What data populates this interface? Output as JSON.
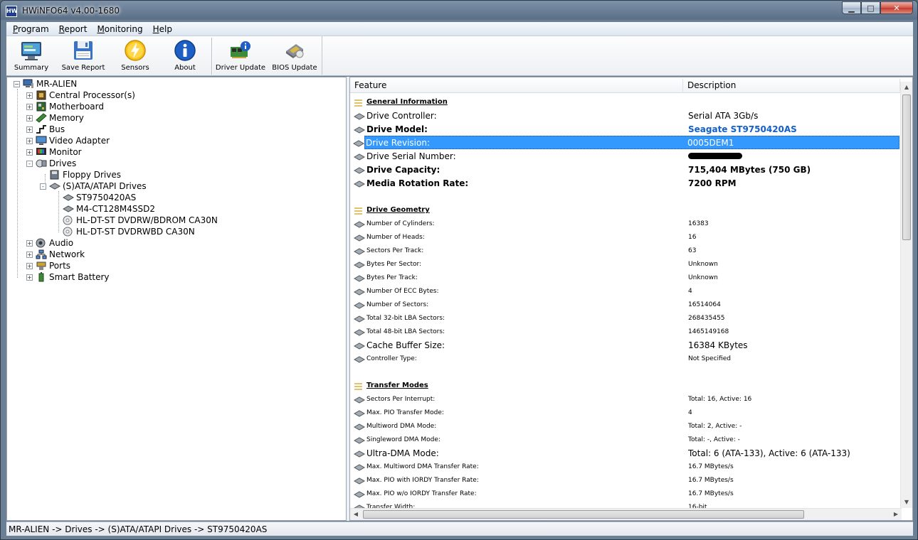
{
  "window": {
    "title": "HWiNFO64 v4.00-1680",
    "app_icon_text": "HW"
  },
  "menu": [
    "Program",
    "Report",
    "Monitoring",
    "Help"
  ],
  "toolbar": {
    "buttons": [
      {
        "label": "Summary",
        "icon": "summary-icon"
      },
      {
        "label": "Save Report",
        "icon": "floppy-disk-icon"
      },
      {
        "label": "Sensors",
        "icon": "sensors-lightning-icon"
      },
      {
        "label": "About",
        "icon": "info-icon"
      },
      {
        "label": "Driver Update",
        "icon": "driver-update-icon"
      },
      {
        "label": "BIOS Update",
        "icon": "bios-chip-icon"
      }
    ]
  },
  "tree": {
    "root": "MR-ALIEN",
    "nodes": [
      {
        "label": "Central Processor(s)",
        "expander": "+"
      },
      {
        "label": "Motherboard",
        "expander": "+"
      },
      {
        "label": "Memory",
        "expander": "+"
      },
      {
        "label": "Bus",
        "expander": "+"
      },
      {
        "label": "Video Adapter",
        "expander": "+"
      },
      {
        "label": "Monitor",
        "expander": "+"
      },
      {
        "label": "Drives",
        "expander": "-"
      },
      {
        "label": "Floppy Drives",
        "expander": ""
      },
      {
        "label": "(S)ATA/ATAPI Drives",
        "expander": "-"
      },
      {
        "label": "ST9750420AS",
        "expander": ""
      },
      {
        "label": "M4-CT128M4SSD2",
        "expander": ""
      },
      {
        "label": "HL-DT-ST DVDRW/BDROM CA30N",
        "expander": ""
      },
      {
        "label": "HL-DT-ST DVDRWBD CA30N",
        "expander": ""
      },
      {
        "label": "Audio",
        "expander": "+"
      },
      {
        "label": "Network",
        "expander": "+"
      },
      {
        "label": "Ports",
        "expander": "+"
      },
      {
        "label": "Smart Battery",
        "expander": "+"
      }
    ]
  },
  "details": {
    "columns": {
      "feature": "Feature",
      "description": "Description"
    },
    "rows": [
      {
        "feature": "General Information",
        "desc": "",
        "kind": "section"
      },
      {
        "feature": "Drive Controller:",
        "desc": "Serial ATA 3Gb/s",
        "kind": "med"
      },
      {
        "feature": "Drive Model:",
        "desc": "Seagate ST9750420AS",
        "kind": "bold-blue"
      },
      {
        "feature": "Drive Revision:",
        "desc": "0005DEM1",
        "kind": "selected"
      },
      {
        "feature": "Drive Serial Number:",
        "desc": "",
        "kind": "redacted"
      },
      {
        "feature": "Drive Capacity:",
        "desc": "715,404 MBytes (750 GB)",
        "kind": "bold"
      },
      {
        "feature": "Media Rotation Rate:",
        "desc": "7200 RPM",
        "kind": "bold"
      },
      {
        "feature": "",
        "desc": "",
        "kind": "blank"
      },
      {
        "feature": "Drive Geometry",
        "desc": "",
        "kind": "section"
      },
      {
        "feature": "Number of Cylinders:",
        "desc": "16383",
        "kind": "small"
      },
      {
        "feature": "Number of Heads:",
        "desc": "16",
        "kind": "small"
      },
      {
        "feature": "Sectors Per Track:",
        "desc": "63",
        "kind": "small"
      },
      {
        "feature": "Bytes Per Sector:",
        "desc": "Unknown",
        "kind": "small"
      },
      {
        "feature": "Bytes Per Track:",
        "desc": "Unknown",
        "kind": "small"
      },
      {
        "feature": "Number Of ECC Bytes:",
        "desc": "4",
        "kind": "small"
      },
      {
        "feature": "Number of Sectors:",
        "desc": "16514064",
        "kind": "small"
      },
      {
        "feature": "Total 32-bit LBA Sectors:",
        "desc": "268435455",
        "kind": "small"
      },
      {
        "feature": "Total 48-bit LBA Sectors:",
        "desc": "1465149168",
        "kind": "small"
      },
      {
        "feature": "Cache Buffer Size:",
        "desc": "16384 KBytes",
        "kind": "med"
      },
      {
        "feature": "Controller Type:",
        "desc": "Not Specified",
        "kind": "small"
      },
      {
        "feature": "",
        "desc": "",
        "kind": "blank"
      },
      {
        "feature": "Transfer Modes",
        "desc": "",
        "kind": "section"
      },
      {
        "feature": "Sectors Per Interrupt:",
        "desc": "Total: 16, Active: 16",
        "kind": "small"
      },
      {
        "feature": "Max. PIO Transfer Mode:",
        "desc": "4",
        "kind": "small"
      },
      {
        "feature": "Multiword DMA Mode:",
        "desc": "Total: 2, Active: -",
        "kind": "small"
      },
      {
        "feature": "Singleword DMA Mode:",
        "desc": "Total: -, Active: -",
        "kind": "small"
      },
      {
        "feature": "Ultra-DMA Mode:",
        "desc": "Total: 6 (ATA-133), Active: 6 (ATA-133)",
        "kind": "med"
      },
      {
        "feature": "Max. Multiword DMA Transfer Rate:",
        "desc": "16.7 MBytes/s",
        "kind": "small"
      },
      {
        "feature": "Max. PIO with IORDY Transfer Rate:",
        "desc": "16.7 MBytes/s",
        "kind": "small"
      },
      {
        "feature": "Max. PIO w/o IORDY Transfer Rate:",
        "desc": "16.7 MBytes/s",
        "kind": "small"
      },
      {
        "feature": "Transfer Width:",
        "desc": "16-bit",
        "kind": "small"
      }
    ]
  },
  "status": "MR-ALIEN -> Drives -> (S)ATA/ATAPI Drives -> ST9750420AS",
  "colors": {
    "selection": "#3399ff",
    "link_blue": "#1460c8"
  }
}
